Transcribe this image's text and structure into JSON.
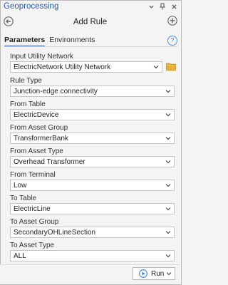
{
  "pane": {
    "title": "Geoprocessing"
  },
  "tool": {
    "title": "Add Rule"
  },
  "tabs": [
    {
      "label": "Parameters"
    },
    {
      "label": "Environments"
    }
  ],
  "fields": [
    {
      "label": "Input Utility Network",
      "value": "ElectricNetwork Utility Network"
    },
    {
      "label": "Rule Type",
      "value": "Junction-edge connectivity"
    },
    {
      "label": "From Table",
      "value": "ElectricDevice"
    },
    {
      "label": "From Asset Group",
      "value": "TransformerBank"
    },
    {
      "label": "From Asset Type",
      "value": "Overhead Transformer"
    },
    {
      "label": "From Terminal",
      "value": "Low"
    },
    {
      "label": "To Table",
      "value": "ElectricLine"
    },
    {
      "label": "To Asset Group",
      "value": "SecondaryOHLineSection"
    },
    {
      "label": "To Asset Type",
      "value": "ALL"
    }
  ],
  "run": {
    "label": "Run"
  },
  "help": {
    "glyph": "?"
  },
  "colors": {
    "accent": "#2b579a",
    "run_icon": "#2b79d0",
    "folder": "#e8b13a"
  }
}
